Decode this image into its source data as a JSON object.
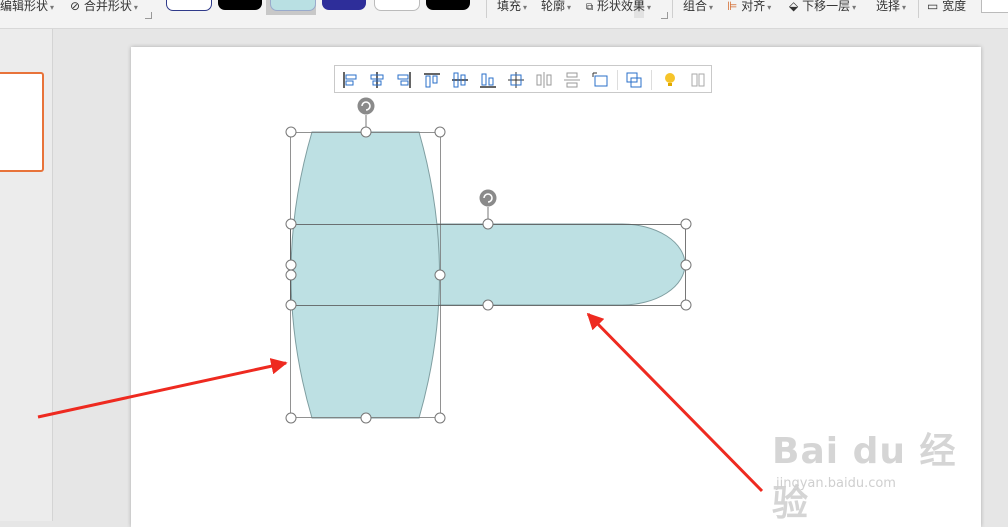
{
  "ribbon": {
    "edit_shape": "编辑形状",
    "merge_shape": "合并形状",
    "fill": "填充",
    "outline": "轮廓",
    "shape_effects": "形状效果",
    "group": "组合",
    "align": "对齐",
    "send_backward": "下移一层",
    "select": "选择",
    "width": "宽度"
  },
  "style_swatches": [
    "outline-blue",
    "black",
    "light-teal-selected",
    "dark-blue",
    "white",
    "black"
  ],
  "quick_toolbar": {
    "buttons": [
      "align-left-icon",
      "align-center-icon",
      "align-right-icon",
      "align-top-icon",
      "align-middle-icon",
      "align-bottom-icon",
      "align-page-center-icon",
      "distribute-horizontal-icon",
      "distribute-vertical-icon",
      "fit-to-canvas-icon",
      "group-icon",
      "tips-bulb-icon",
      "more-icon"
    ]
  },
  "shapes": {
    "fill_color": "#bde0e3",
    "stroke_color": "#7f9ea1",
    "arrow_color": "#ee2a20"
  },
  "watermark": {
    "main": "Bai du 经验",
    "sub": "jingyan.baidu.com"
  }
}
